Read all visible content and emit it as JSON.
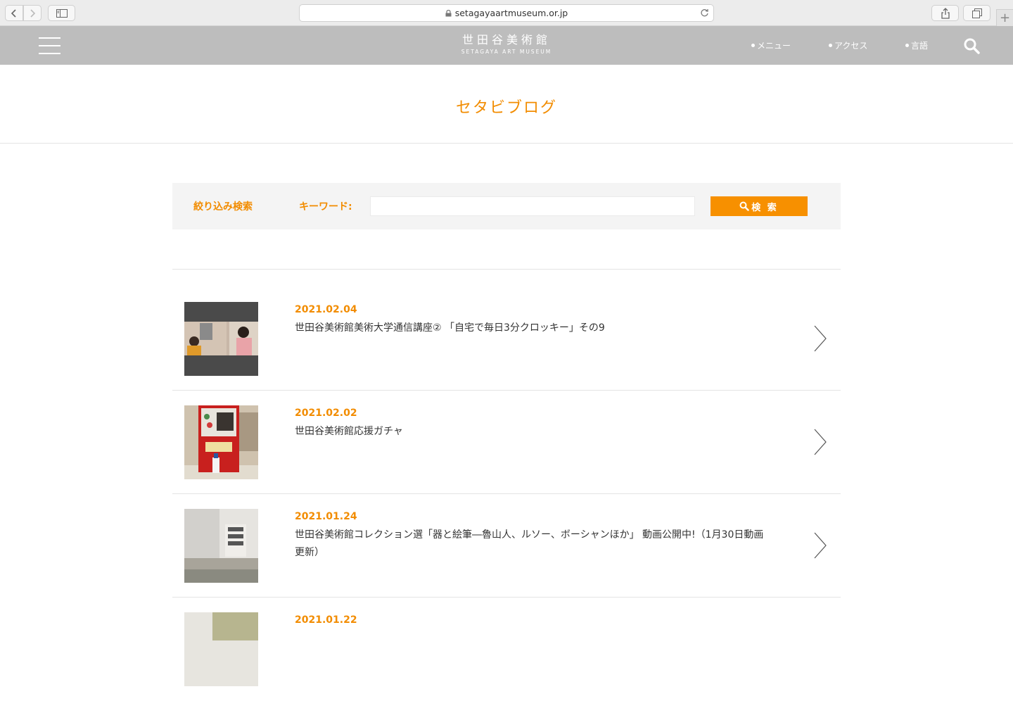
{
  "browser": {
    "url": "setagayaartmuseum.or.jp"
  },
  "header": {
    "logo_jp": "世田谷美術館",
    "logo_en": "SETAGAYA ART MUSEUM",
    "links": [
      "メニュー",
      "アクセス",
      "言語"
    ]
  },
  "page": {
    "title": "セタビブログ"
  },
  "search": {
    "filter_label": "絞り込み検索",
    "keyword_label": "キーワード:",
    "keyword_value": "",
    "button_label": "検 索"
  },
  "posts": [
    {
      "date": "2021.02.04",
      "title": "世田谷美術館美術大学通信講座② 「自宅で毎日3分クロッキー」その9"
    },
    {
      "date": "2021.02.02",
      "title": "世田谷美術館応援ガチャ"
    },
    {
      "date": "2021.01.24",
      "title": "世田谷美術館コレクション選「器と絵筆―魯山人、ルソー、ボーシャンほか」 動画公開中!（1月30日動画更新）"
    },
    {
      "date": "2021.01.22",
      "title": ""
    }
  ],
  "colors": {
    "accent": "#f28c00",
    "header_bg": "#bdbdbd",
    "search_button": "#f79000"
  }
}
